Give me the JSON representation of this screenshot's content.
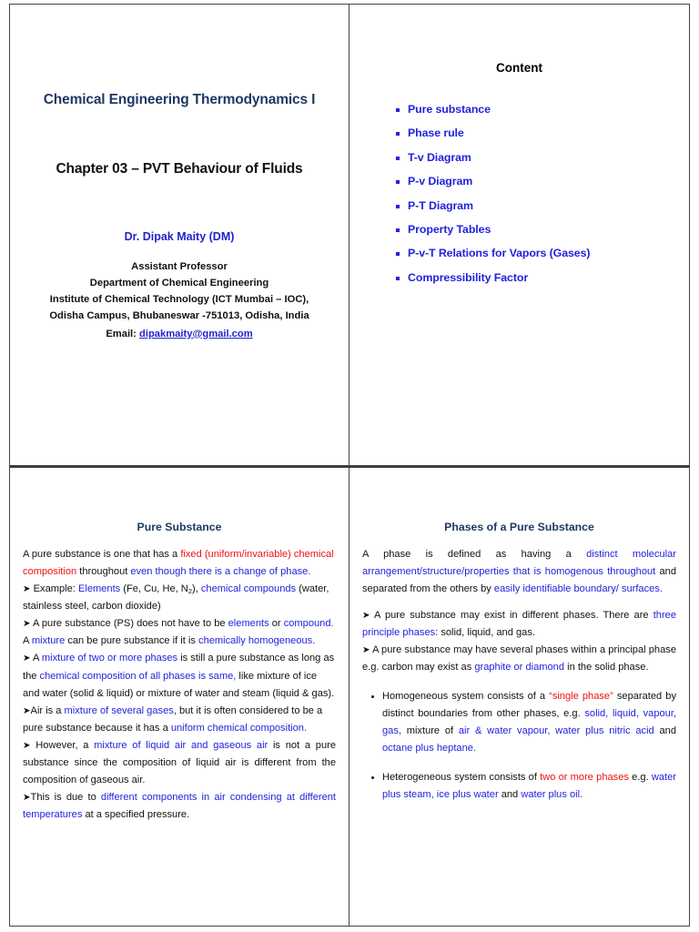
{
  "document": {
    "type": "lecture-slide-handout",
    "slide_count": 4,
    "layout": "2x2"
  },
  "slide_title": {
    "course_title": "Chemical Engineering Thermodynamics I",
    "chapter_title": "Chapter 03 – PVT Behaviour of Fluids",
    "author": "Dr. Dipak Maity (DM)",
    "affiliation": [
      "Assistant Professor",
      "Department of Chemical Engineering",
      "Institute of Chemical Technology (ICT Mumbai – IOC),",
      "Odisha Campus, Bhubaneswar -751013, Odisha, India"
    ],
    "email_label": "Email:",
    "email": "dipakmaity@gmail.com"
  },
  "slide_content": {
    "heading": "Content",
    "items": [
      "Pure substance",
      "Phase rule",
      "T-v Diagram",
      "P-v Diagram",
      "P-T Diagram",
      "Property Tables",
      "P-v-T Relations for Vapors (Gases)",
      "Compressibility Factor"
    ]
  },
  "slide_pure_substance": {
    "heading": "Pure Substance",
    "p1": {
      "t1": "A pure substance is one that has a ",
      "r1": "fixed (uniform/invariable) chemical composition",
      "t2": " throughout ",
      "b1": "even though there is a change of phase."
    },
    "p2": {
      "arrow": "➤",
      "t1": " Example: ",
      "b1": "Elements",
      "t2": " (Fe, Cu, He, N",
      "sub": "2",
      "t3": "), ",
      "b2": "chemical compounds",
      "t4": " (water, stainless steel, carbon dioxide)"
    },
    "p3": {
      "arrow": "➤",
      "t1": " A pure substance (PS) does not have to be ",
      "b1": "elements",
      "t2": " or ",
      "b2": "compound.",
      "t3": " A ",
      "b3": "mixture",
      "t4": " can be pure substance if it is ",
      "b4": "chemically homogeneous."
    },
    "p4": {
      "arrow": "➤",
      "t1": " A ",
      "b1": "mixture of two or more phases",
      "t2": " is still a pure substance as long as the ",
      "b2": "chemical composition of all phases is same,",
      "t3": " like mixture of ice and water (solid & liquid) or mixture of water and steam (liquid & gas)."
    },
    "p5": {
      "arrow": "➤",
      "t1": "Air is a ",
      "b1": "mixture of several gases",
      "t2": ", but it is often considered to be a pure substance because it has a ",
      "b2": "uniform chemical composition."
    },
    "p6": {
      "arrow": "➤",
      "t1": " However, a ",
      "b1": "mixture of liquid air and gaseous air",
      "t2": " is not a pure substance since the composition of liquid air is different from the composition of gaseous air."
    },
    "p7": {
      "arrow": "➤",
      "t1": "This is due to ",
      "b1": "different components in air condensing at different temperatures",
      "t2": " at a specified pressure."
    }
  },
  "slide_phases": {
    "heading": "Phases of a Pure Substance",
    "p1": {
      "t1": "A phase is defined as having a ",
      "b1": "distinct molecular arrangement/structure/properties that is homogenous throughout",
      "t2": " and separated from the others by ",
      "b2": "easily identifiable boundary/ surfaces."
    },
    "p2": {
      "arrow": "➤",
      "t1": " A pure substance may exist in different phases. There are ",
      "b1": "three principle phases",
      "t2": ": solid, liquid, and gas."
    },
    "p3": {
      "arrow": "➤",
      "t1": " A pure substance may have several phases within a principal phase e.g. carbon may exist as ",
      "b1": "graphite or diamond",
      "t2": " in the solid phase."
    },
    "bullets": [
      {
        "t1": "Homogeneous system consists of a ",
        "r1": "“single phase”",
        "t2": " separated by distinct boundaries from other phases, e.g. ",
        "b1": "solid, liquid, vapour, gas,",
        "t3": " mixture of ",
        "b2": "air & water vapour, water plus nitric acid",
        "t4": " and ",
        "b3": "octane plus heptane."
      },
      {
        "t1": " Heterogeneous system consists of ",
        "r1": "two or more phases",
        "t2": " e.g. ",
        "b1": "water plus steam, ice plus water",
        "t3": " and ",
        "b2": "water plus oil."
      }
    ]
  },
  "colors": {
    "heading_navy": "#1F3864",
    "blue_text": "#2222DD",
    "red_text": "#EE1111",
    "black_text": "#111111",
    "border": "#444444"
  }
}
